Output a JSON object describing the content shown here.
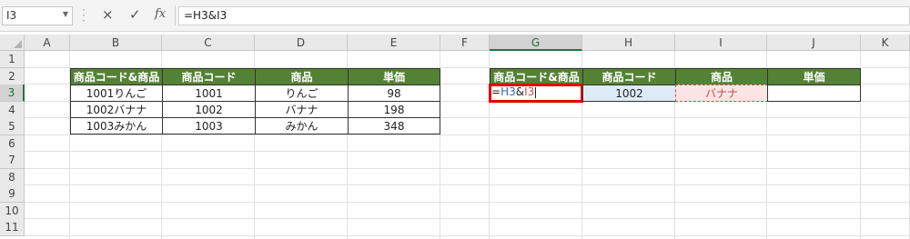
{
  "formula_bar": {
    "name_box": "I3",
    "cancel_icon": "×",
    "enter_icon": "✓",
    "fx_label": "fx",
    "formula": "=H3&I3"
  },
  "columns": [
    "A",
    "B",
    "C",
    "D",
    "E",
    "F",
    "G",
    "H",
    "I",
    "J",
    "K"
  ],
  "selected_column": "G",
  "rows": [
    "1",
    "2",
    "3",
    "4",
    "5",
    "6",
    "7",
    "8",
    "9",
    "10",
    "11"
  ],
  "selected_row": "3",
  "table1": {
    "headers": [
      "商品コード&商品",
      "商品コード",
      "商品",
      "単価"
    ],
    "rows": [
      [
        "1001りんご",
        "1001",
        "りんご",
        "98"
      ],
      [
        "1002バナナ",
        "1002",
        "バナナ",
        "198"
      ],
      [
        "1003みかん",
        "1003",
        "みかん",
        "348"
      ]
    ]
  },
  "table2": {
    "headers": [
      "商品コード&商品",
      "商品コード",
      "商品",
      "単価"
    ],
    "row": {
      "formula_eq": "=",
      "formula_ref1": "H3",
      "formula_amp": "&",
      "formula_ref2": "I3",
      "code": "1002",
      "name": "バナナ",
      "price": ""
    }
  },
  "colors": {
    "header_fill": "#548235",
    "active_border": "#e00000",
    "ref1_color": "#2f6eba",
    "ref2_color": "#c0504d"
  }
}
